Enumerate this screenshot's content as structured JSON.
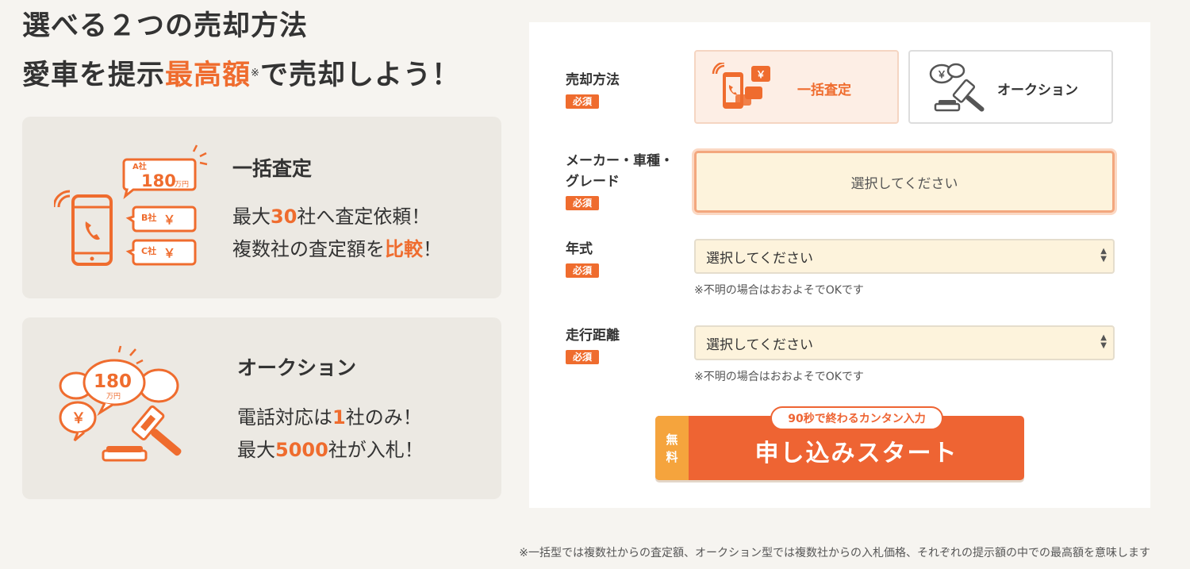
{
  "headline": {
    "line1": "選べる２つの売却方法",
    "line2_pre": "愛車を提示",
    "line2_highlight": "最高額",
    "line2_mark": "※",
    "line2_post": "で売却しよう！"
  },
  "cards": [
    {
      "title": "一括査定",
      "line1_pre": "最大",
      "line1_num": "30",
      "line1_post": "社へ査定依頼！",
      "line2_pre": "複数社の査定額を",
      "line2_num": "比較",
      "line2_post": "！",
      "illus": {
        "a_label": "A社",
        "a_value": "180",
        "a_unit": "万円",
        "b_label": "B社",
        "c_label": "C社",
        "yen": "￥"
      }
    },
    {
      "title": "オークション",
      "line1_pre": "電話対応は",
      "line1_num": "1",
      "line1_post": "社のみ！",
      "line2_pre": "最大",
      "line2_num": "5000",
      "line2_post": "社が入札！",
      "illus": {
        "value": "180",
        "unit": "万円",
        "yen": "￥"
      }
    }
  ],
  "form": {
    "required_label": "必須",
    "method": {
      "label": "売却方法",
      "options": [
        {
          "label": "一括査定",
          "selected": true,
          "icon": "phone-bubbles-icon"
        },
        {
          "label": "オークション",
          "selected": false,
          "icon": "gavel-icon"
        }
      ],
      "yen": "￥"
    },
    "maker": {
      "label_line1": "メーカー・車種・",
      "label_line2": "グレード",
      "placeholder": "選択してください"
    },
    "year": {
      "label": "年式",
      "value": "選択してください",
      "note": "※不明の場合はおおよそでOKです"
    },
    "mileage": {
      "label": "走行距離",
      "value": "選択してください",
      "note": "※不明の場合はおおよそでOKです"
    },
    "cta": {
      "free_1": "無",
      "free_2": "料",
      "badge": "90秒で終わるカンタン入力",
      "label": "申し込みスタート"
    }
  },
  "footnote": "※一括型では複数社からの査定額、オークション型では複数社からの入札価格、それぞれの提示額の中での最高額を意味します",
  "colors": {
    "accent": "#ef6c2e",
    "free": "#f5a43d",
    "field_bg": "#fdf3dc",
    "card_bg": "#ece9e3"
  }
}
